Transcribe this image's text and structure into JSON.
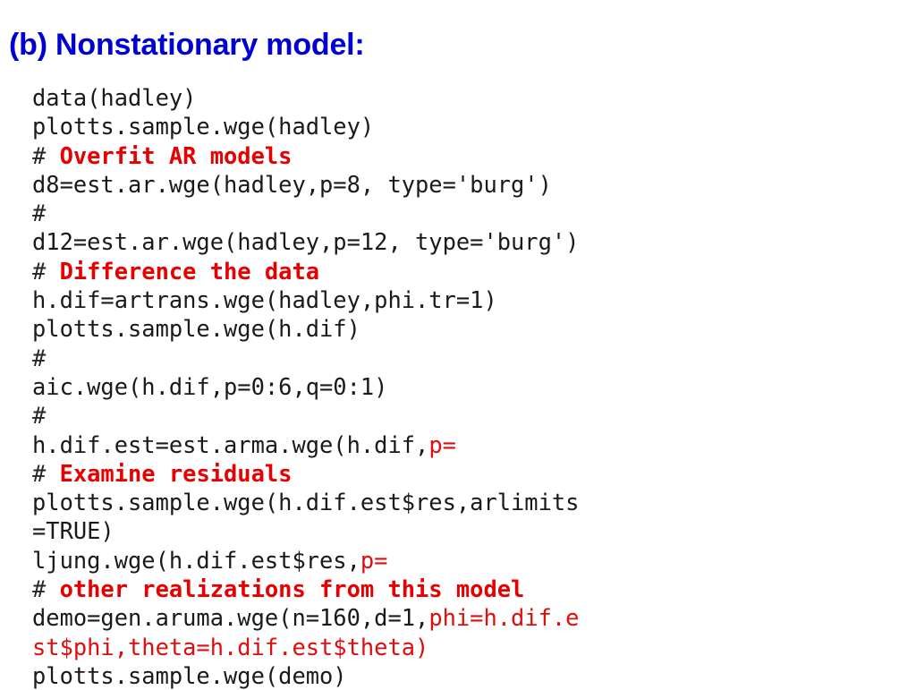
{
  "slide": {
    "title": "(b) Nonstationary model:",
    "title_color": "#0000d2",
    "background_color": "#ffffff",
    "code_plain_color": "#1a1a1a",
    "code_red_color": "#e00d0d",
    "code_comment_color": "#e80000"
  },
  "code": {
    "language": "R",
    "lines": [
      {
        "id": "line-1",
        "text": "data(hadley)",
        "segments": [
          {
            "text": "data(hadley)",
            "style": "plain"
          }
        ]
      },
      {
        "id": "line-2",
        "text": "plotts.sample.wge(hadley)",
        "segments": [
          {
            "text": "plotts.sample.wge(hadley)",
            "style": "plain"
          }
        ]
      },
      {
        "id": "line-3",
        "text": "# Overfit AR models",
        "segments": [
          {
            "text": "# ",
            "style": "hash"
          },
          {
            "text": "Overfit AR models",
            "style": "red-bold"
          }
        ]
      },
      {
        "id": "line-4",
        "text": "d8=est.ar.wge(hadley,p=8, type='burg')",
        "segments": [
          {
            "text": "d8=est.ar.wge(hadley,p=8, type='burg')",
            "style": "plain"
          }
        ]
      },
      {
        "id": "line-5",
        "text": "#",
        "segments": [
          {
            "text": "#",
            "style": "hash"
          }
        ]
      },
      {
        "id": "line-6",
        "text": "d12=est.ar.wge(hadley,p=12, type='burg')",
        "segments": [
          {
            "text": "d12=est.ar.wge(hadley,p=12, type='burg')",
            "style": "plain"
          }
        ]
      },
      {
        "id": "line-7",
        "text": "# Difference the data",
        "segments": [
          {
            "text": "# ",
            "style": "hash"
          },
          {
            "text": "Difference the data",
            "style": "red-bold"
          }
        ]
      },
      {
        "id": "line-8",
        "text": "h.dif=artrans.wge(hadley,phi.tr=1)",
        "segments": [
          {
            "text": "h.dif=artrans.wge(hadley,phi.tr=1)",
            "style": "plain"
          }
        ]
      },
      {
        "id": "line-9",
        "text": "plotts.sample.wge(h.dif)",
        "segments": [
          {
            "text": "plotts.sample.wge(h.dif)",
            "style": "plain"
          }
        ]
      },
      {
        "id": "line-10",
        "text": "#",
        "segments": [
          {
            "text": "#",
            "style": "hash"
          }
        ]
      },
      {
        "id": "line-11",
        "text": "aic.wge(h.dif,p=0:6,q=0:1)",
        "segments": [
          {
            "text": "aic.wge(h.dif,p=0:6,q=0:1)",
            "style": "plain"
          }
        ]
      },
      {
        "id": "line-12",
        "text": "#",
        "segments": [
          {
            "text": "#",
            "style": "hash"
          }
        ]
      },
      {
        "id": "line-13",
        "text": "h.dif.est=est.arma.wge(h.dif,p=",
        "segments": [
          {
            "text": "h.dif.est=est.arma.wge(h.dif,",
            "style": "plain"
          },
          {
            "text": "p=",
            "style": "red"
          }
        ]
      },
      {
        "id": "line-14",
        "text": "# Examine residuals",
        "segments": [
          {
            "text": "# ",
            "style": "hash"
          },
          {
            "text": "Examine residuals",
            "style": "red-bold"
          }
        ]
      },
      {
        "id": "line-15",
        "text": "plotts.sample.wge(h.dif.est$res,arlimits",
        "segments": [
          {
            "text": "plotts.sample.wge(h.dif.est$res,arlimits",
            "style": "plain"
          }
        ]
      },
      {
        "id": "line-16",
        "text": "=TRUE)",
        "segments": [
          {
            "text": "=TRUE)",
            "style": "plain"
          }
        ]
      },
      {
        "id": "line-17",
        "text": "ljung.wge(h.dif.est$res,p=",
        "segments": [
          {
            "text": "ljung.wge(h.dif.est$res,",
            "style": "plain"
          },
          {
            "text": "p=",
            "style": "red"
          }
        ]
      },
      {
        "id": "line-18",
        "text": "# other realizations from this model",
        "segments": [
          {
            "text": "# ",
            "style": "hash"
          },
          {
            "text": "other realizations from this model",
            "style": "red-bold"
          }
        ]
      },
      {
        "id": "line-19",
        "text": "demo=gen.aruma.wge(n=160,d=1,phi=h.dif.e",
        "segments": [
          {
            "text": "demo=gen.aruma.wge(n=160,d=1,",
            "style": "plain"
          },
          {
            "text": "phi=h.dif.e",
            "style": "red"
          }
        ]
      },
      {
        "id": "line-20",
        "text": "st$phi,theta=h.dif.est$theta)",
        "segments": [
          {
            "text": "st$phi,theta=h.dif.est$theta)",
            "style": "red"
          }
        ]
      },
      {
        "id": "line-21",
        "text": "plotts.sample.wge(demo)",
        "segments": [
          {
            "text": "plotts.sample.wge(demo)",
            "style": "plain"
          }
        ]
      }
    ]
  }
}
